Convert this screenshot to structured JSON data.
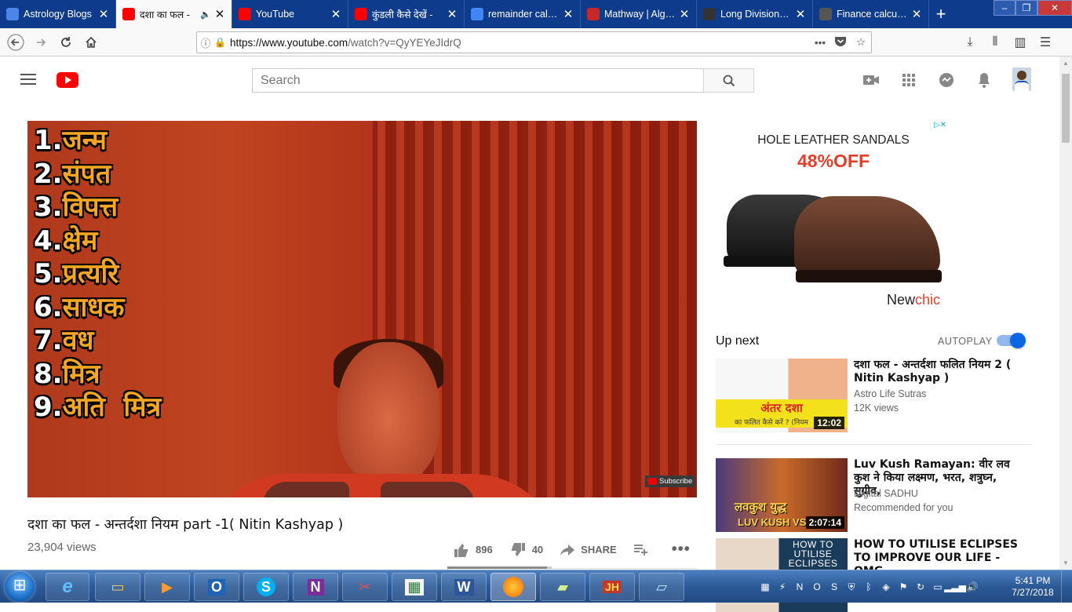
{
  "browser": {
    "tabs": [
      {
        "label": "Astrology Blogs",
        "favicon_color": "#4a86e8"
      },
      {
        "label": "दशा का फल -",
        "favicon_color": "#ff0000",
        "active": true
      },
      {
        "label": "YouTube",
        "favicon_color": "#ff0000"
      },
      {
        "label": "कुंडली कैसे देखें -",
        "favicon_color": "#ff0000"
      },
      {
        "label": "remainder calcul",
        "favicon_color": "#4285f4"
      },
      {
        "label": "Mathway | Algeb",
        "favicon_color": "#c62828"
      },
      {
        "label": "Long Division Ca",
        "favicon_color": "#333333"
      },
      {
        "label": "Finance calculato",
        "favicon_color": "#555555"
      }
    ],
    "new_tab": "+",
    "url_host": "https://www.youtube.com",
    "url_rest": "/watch?v=QyYEYeJIdrQ"
  },
  "youtube": {
    "search_placeholder": "Search",
    "video": {
      "overlay_list": [
        {
          "num": "1.",
          "word": "जन्म"
        },
        {
          "num": "2.",
          "word": "संपत"
        },
        {
          "num": "3.",
          "word": "विपत्त"
        },
        {
          "num": "4.",
          "word": "क्षेम"
        },
        {
          "num": "5.",
          "word": "प्रत्यरि"
        },
        {
          "num": "6.",
          "word": "साधक"
        },
        {
          "num": "7.",
          "word": "वध"
        },
        {
          "num": "8.",
          "word": "मित्र"
        },
        {
          "num": "9.",
          "word": "अति  मित्र"
        }
      ],
      "watermark": "Subscribe",
      "title": "दशा का फल - अन्तर्दशा नियम part -1( Nitin Kashyap )",
      "views": "23,904 views",
      "likes": "896",
      "dislikes": "40",
      "share_label": "SHARE",
      "like_ratio": 0.957
    },
    "ad": {
      "title": "HOLE LEATHER SANDALS",
      "offer": "48%OFF",
      "brand_a": "New",
      "brand_b": "chic",
      "tag": "▷✕"
    },
    "up_next_label": "Up next",
    "autoplay_label": "AUTOPLAY",
    "recommendations": [
      {
        "title": "दशा फल - अन्तर्दशा फलित नियम 2 ( Nitin Kashyap )",
        "channel": "Astro Life Sutras",
        "meta": "12K views",
        "duration": "12:02",
        "thumb_banner": "अंतर दशा",
        "thumb_sub": "का फलित कैसे करें ? (नियम"
      },
      {
        "title": "Luv Kush Ramayan: वीर लव कुश ने किया लक्ष्मण, भरत, शत्रुघ्न, सुग्रीव,",
        "channel": "Digital SADHU",
        "meta": "Recommended for you",
        "duration": "2:07:14",
        "thumb_banner": "लवकुश युद्ध",
        "thumb_sub": "LUV KUSH VS"
      },
      {
        "title": "HOW TO UTILISE ECLIPSES TO IMPROVE OUR LIFE - OMG",
        "channel": "",
        "meta": "",
        "duration": "",
        "thumb_banner": "HOW TO UTILISE ECLIPSES",
        "thumb_sub": ""
      }
    ]
  },
  "taskbar": {
    "clock_time": "5:41 PM",
    "clock_date": "7/27/2018"
  }
}
